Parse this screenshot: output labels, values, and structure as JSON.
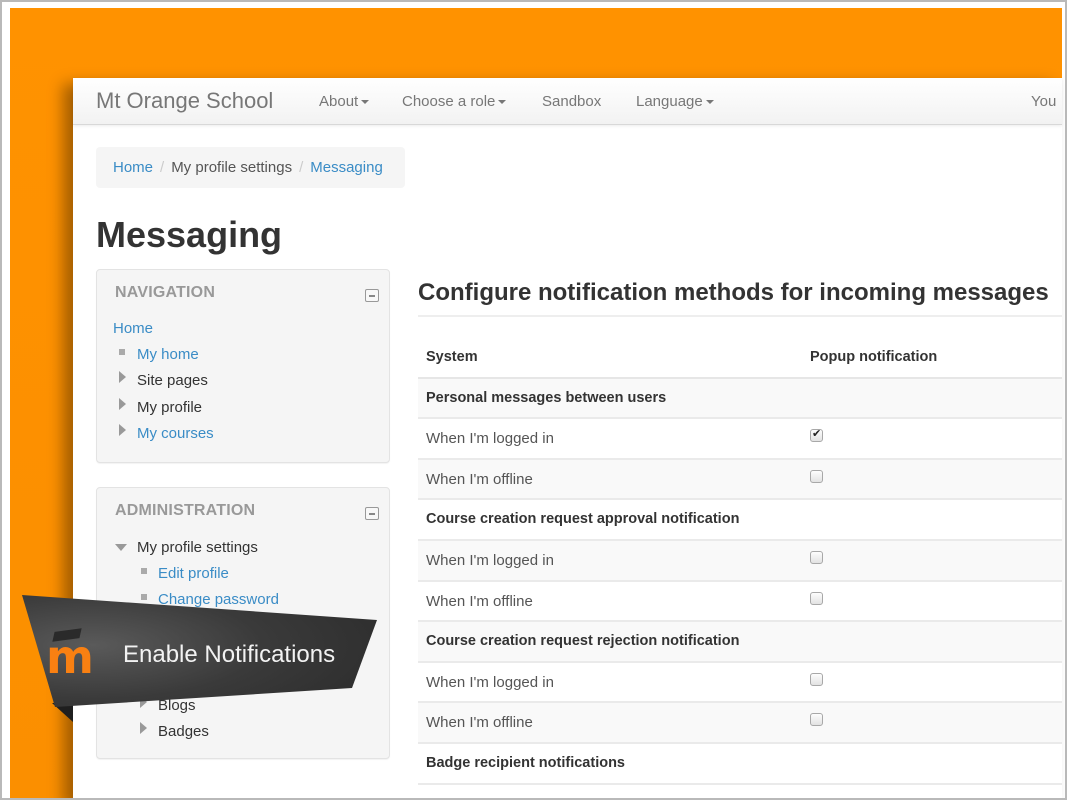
{
  "navbar": {
    "brand": "Mt Orange School",
    "items": [
      {
        "label": "About",
        "dropdown": true
      },
      {
        "label": "Choose a role",
        "dropdown": true
      },
      {
        "label": "Sandbox",
        "dropdown": false
      },
      {
        "label": "Language",
        "dropdown": true
      }
    ],
    "user_label": "You"
  },
  "breadcrumb": {
    "items": [
      "Home",
      "My profile settings",
      "Messaging"
    ],
    "separator": "/"
  },
  "page_title": "Messaging",
  "navigation_block": {
    "title": "NAVIGATION",
    "home": "Home",
    "items": [
      {
        "label": "My home",
        "marker": "bullet",
        "link": true
      },
      {
        "label": "Site pages",
        "marker": "collapsed",
        "link": false
      },
      {
        "label": "My profile",
        "marker": "collapsed",
        "link": false
      },
      {
        "label": "My courses",
        "marker": "collapsed",
        "link": true
      }
    ]
  },
  "administration_block": {
    "title": "ADMINISTRATION",
    "parent": "My profile settings",
    "items": [
      {
        "label": "Edit profile",
        "marker": "bullet",
        "link": true
      },
      {
        "label": "Change password",
        "marker": "bullet",
        "link": true
      },
      {
        "label": "Blogs",
        "marker": "collapsed",
        "link": false
      },
      {
        "label": "Badges",
        "marker": "collapsed",
        "link": false
      }
    ]
  },
  "main": {
    "section_title": "Configure notification methods for incoming messages",
    "columns": [
      "System",
      "Popup notification"
    ],
    "groups": [
      {
        "title": "Personal messages between users",
        "rows": [
          {
            "label": "When I'm logged in",
            "popup": true
          },
          {
            "label": "When I'm offline",
            "popup": false
          }
        ]
      },
      {
        "title": "Course creation request approval notification",
        "rows": [
          {
            "label": "When I'm logged in",
            "popup": false
          },
          {
            "label": "When I'm offline",
            "popup": false
          }
        ]
      },
      {
        "title": "Course creation request rejection notification",
        "rows": [
          {
            "label": "When I'm logged in",
            "popup": false
          },
          {
            "label": "When I'm offline",
            "popup": false
          }
        ]
      },
      {
        "title": "Badge recipient notifications",
        "rows": []
      }
    ]
  },
  "overlay_banner": {
    "text": "Enable Notifications",
    "logo_letter": "m"
  },
  "colors": {
    "background_orange": "#ff9200",
    "link_blue": "#3a8cc6",
    "banner_dark": "#3a3a3a",
    "logo_orange": "#f98012"
  }
}
